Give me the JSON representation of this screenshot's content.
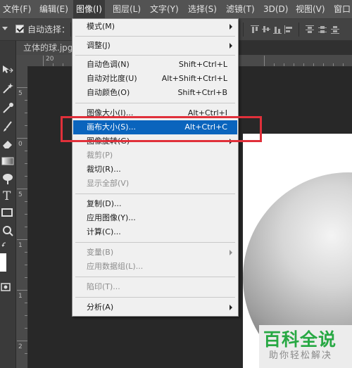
{
  "menubar": {
    "items": [
      {
        "label": "文件(F)"
      },
      {
        "label": "编辑(E)"
      },
      {
        "label": "图像(I)",
        "active": true
      },
      {
        "label": "图层(L)"
      },
      {
        "label": "文字(Y)"
      },
      {
        "label": "选择(S)"
      },
      {
        "label": "滤镜(T)"
      },
      {
        "label": "3D(D)"
      },
      {
        "label": "视图(V)"
      },
      {
        "label": "窗口"
      }
    ]
  },
  "options_bar": {
    "auto_select_label": "自动选择：",
    "auto_select_checked": true
  },
  "document": {
    "tab_title": "立体的球.jpg"
  },
  "rulers": {
    "horizontal_labels": [
      "20"
    ],
    "vertical_labels": [
      "5",
      "0",
      "5",
      "1",
      "1",
      "2"
    ]
  },
  "image_menu": {
    "items": [
      {
        "label": "模式(M)",
        "submenu": true
      },
      {
        "label": "调整(J)",
        "submenu": true
      },
      {
        "label": "自动色调(N)",
        "shortcut": "Shift+Ctrl+L"
      },
      {
        "label": "自动对比度(U)",
        "shortcut": "Alt+Shift+Ctrl+L"
      },
      {
        "label": "自动颜色(O)",
        "shortcut": "Shift+Ctrl+B"
      },
      {
        "label": "图像大小(I)...",
        "shortcut": "Alt+Ctrl+I"
      },
      {
        "label": "画布大小(S)...",
        "shortcut": "Alt+Ctrl+C",
        "highlighted": true
      },
      {
        "label": "图像旋转(G)",
        "submenu": true
      },
      {
        "label": "裁剪(P)",
        "disabled": true
      },
      {
        "label": "裁切(R)..."
      },
      {
        "label": "显示全部(V)",
        "disabled": true
      },
      {
        "label": "复制(D)..."
      },
      {
        "label": "应用图像(Y)..."
      },
      {
        "label": "计算(C)..."
      },
      {
        "label": "变量(B)",
        "submenu": true,
        "disabled": true
      },
      {
        "label": "应用数据组(L)...",
        "disabled": true
      },
      {
        "label": "陷印(T)...",
        "disabled": true
      },
      {
        "label": "分析(A)",
        "submenu": true
      }
    ]
  },
  "watermark": {
    "title": "百科全说",
    "subtitle": "助你轻松解决"
  },
  "colors": {
    "highlight": "#0a64bd",
    "annotation_box": "#e0303a",
    "watermark_green": "#27a843"
  }
}
